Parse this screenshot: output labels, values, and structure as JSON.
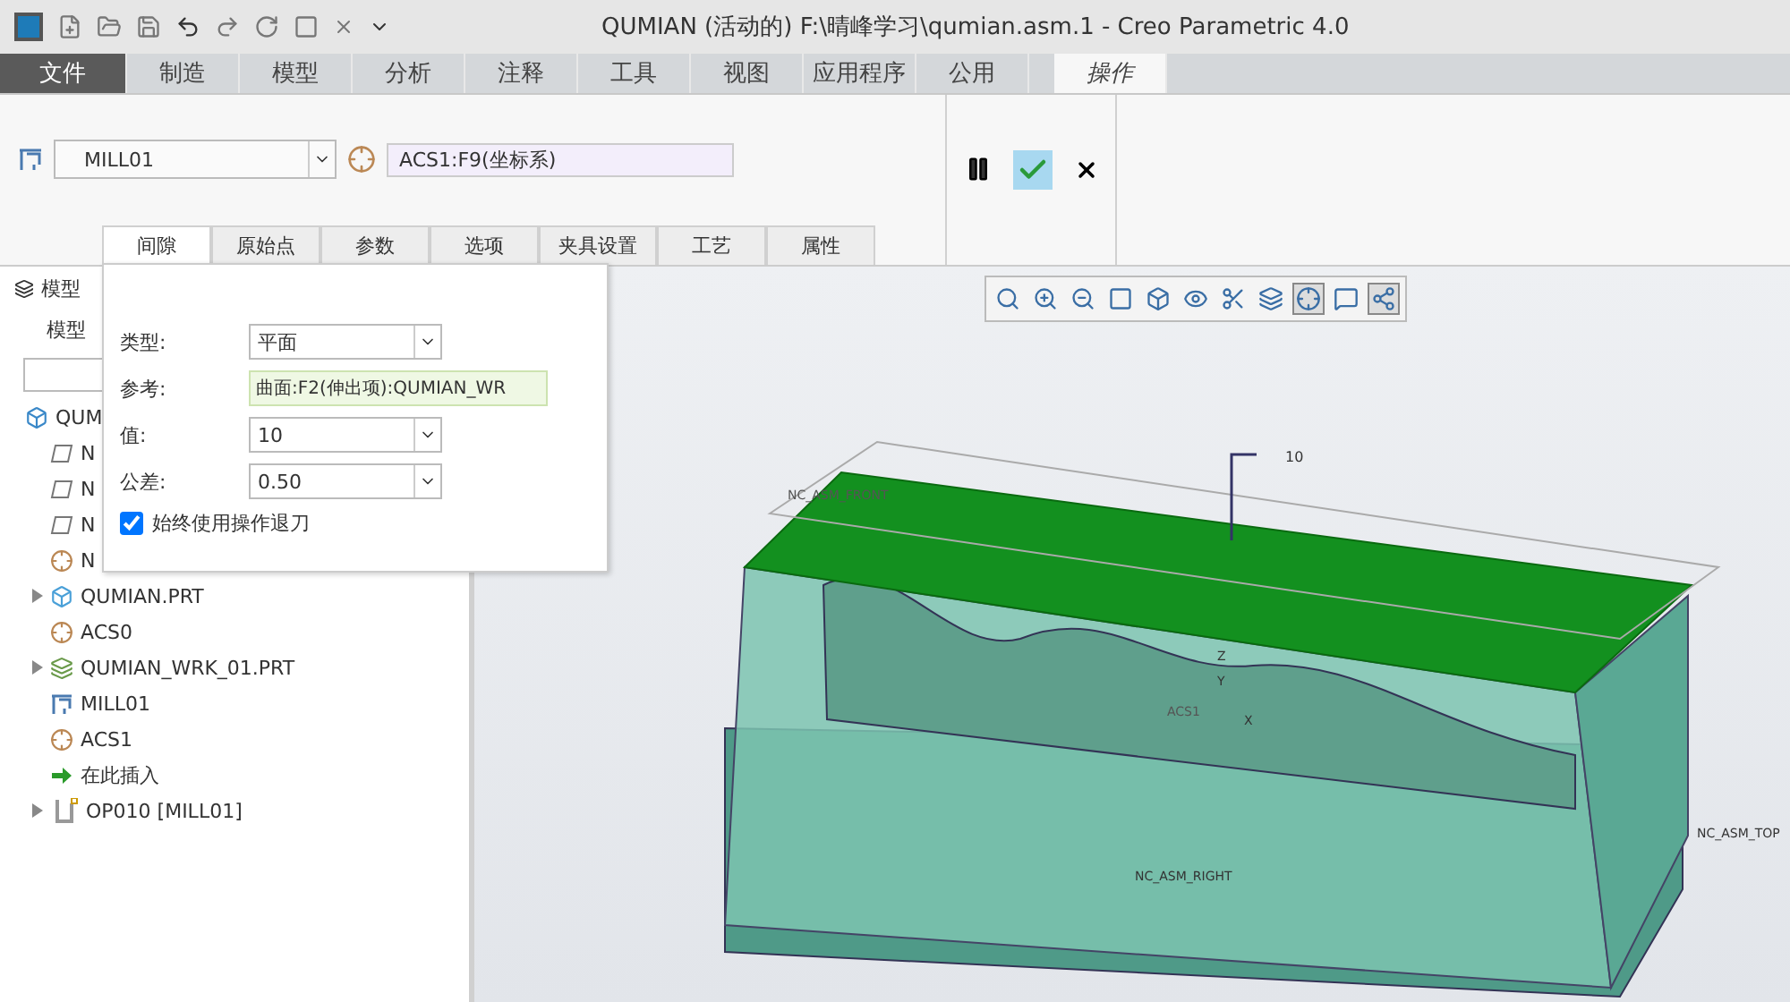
{
  "window": {
    "title": "QUMIAN (活动的) F:\\晴峰学习\\qumian.asm.1 - Creo Parametric 4.0"
  },
  "ribbon_tabs": [
    {
      "label": "文件",
      "kind": "file",
      "selected": false
    },
    {
      "label": "制造",
      "kind": "tab",
      "selected": false
    },
    {
      "label": "模型",
      "kind": "tab",
      "selected": false
    },
    {
      "label": "分析",
      "kind": "tab",
      "selected": false
    },
    {
      "label": "注释",
      "kind": "tab",
      "selected": false
    },
    {
      "label": "工具",
      "kind": "tab",
      "selected": false
    },
    {
      "label": "视图",
      "kind": "tab",
      "selected": false
    },
    {
      "label": "应用程序",
      "kind": "tab",
      "selected": false
    },
    {
      "label": "公用",
      "kind": "tab",
      "selected": false
    },
    {
      "label": "操作",
      "kind": "tab",
      "selected": true
    }
  ],
  "operation": {
    "work_center": "MILL01",
    "csys": "ACS1:F9(坐标系)",
    "confirm_selected": true
  },
  "sub_tabs": [
    {
      "label": "间隙",
      "selected": true
    },
    {
      "label": "原始点",
      "selected": false
    },
    {
      "label": "参数",
      "selected": false
    },
    {
      "label": "选项",
      "selected": false
    },
    {
      "label": "夹具设置",
      "selected": false
    },
    {
      "label": "工艺",
      "selected": false
    },
    {
      "label": "属性",
      "selected": false
    }
  ],
  "clearance_panel": {
    "fields": [
      {
        "label": "类型:",
        "kind": "select",
        "value": "平面"
      },
      {
        "label": "参考:",
        "kind": "reference",
        "value": "曲面:F2(伸出项):QUMIAN_WR"
      },
      {
        "label": "值:",
        "kind": "select",
        "value": "10"
      },
      {
        "label": "公差:",
        "kind": "select",
        "value": "0.50"
      }
    ],
    "retract": {
      "label": "始终使用操作退刀",
      "checked": true
    }
  },
  "model_tree": {
    "title": "模型",
    "subtitle": "模型",
    "items": [
      {
        "label": "QUM",
        "kind": "assembly",
        "children": [
          {
            "label": "N",
            "kind": "plane"
          },
          {
            "label": "N",
            "kind": "plane"
          },
          {
            "label": "N",
            "kind": "plane"
          },
          {
            "label": "N",
            "kind": "csys"
          },
          {
            "label": "QUMIAN.PRT",
            "kind": "part",
            "expanded": false
          },
          {
            "label": "ACS0",
            "kind": "csys"
          },
          {
            "label": "QUMIAN_WRK_01.PRT",
            "kind": "workpiece",
            "expanded": false
          },
          {
            "label": "MILL01",
            "kind": "mill"
          },
          {
            "label": "ACS1",
            "kind": "csys"
          },
          {
            "label": "在此插入",
            "kind": "insert"
          },
          {
            "label": "OP010 [MILL01]",
            "kind": "operation",
            "expanded": false
          }
        ]
      }
    ]
  },
  "view_toolbar": [
    {
      "kind": "refit",
      "selected": false
    },
    {
      "kind": "zoom-in",
      "selected": false
    },
    {
      "kind": "zoom-out",
      "selected": false
    },
    {
      "kind": "repaint",
      "selected": false
    },
    {
      "kind": "orient",
      "selected": false
    },
    {
      "kind": "views",
      "selected": false
    },
    {
      "kind": "section",
      "selected": false
    },
    {
      "kind": "display",
      "selected": false
    },
    {
      "kind": "datum",
      "selected": true
    },
    {
      "kind": "annotation",
      "selected": false
    },
    {
      "kind": "spin",
      "selected": true
    }
  ],
  "model_labels": {
    "dimension": "10",
    "front": "NC_ASM_FRONT",
    "csys": "ACS1",
    "right": "NC_ASM_RIGHT",
    "top": "NC_ASM_TOP",
    "axes": [
      "Z",
      "Y",
      "X"
    ]
  }
}
